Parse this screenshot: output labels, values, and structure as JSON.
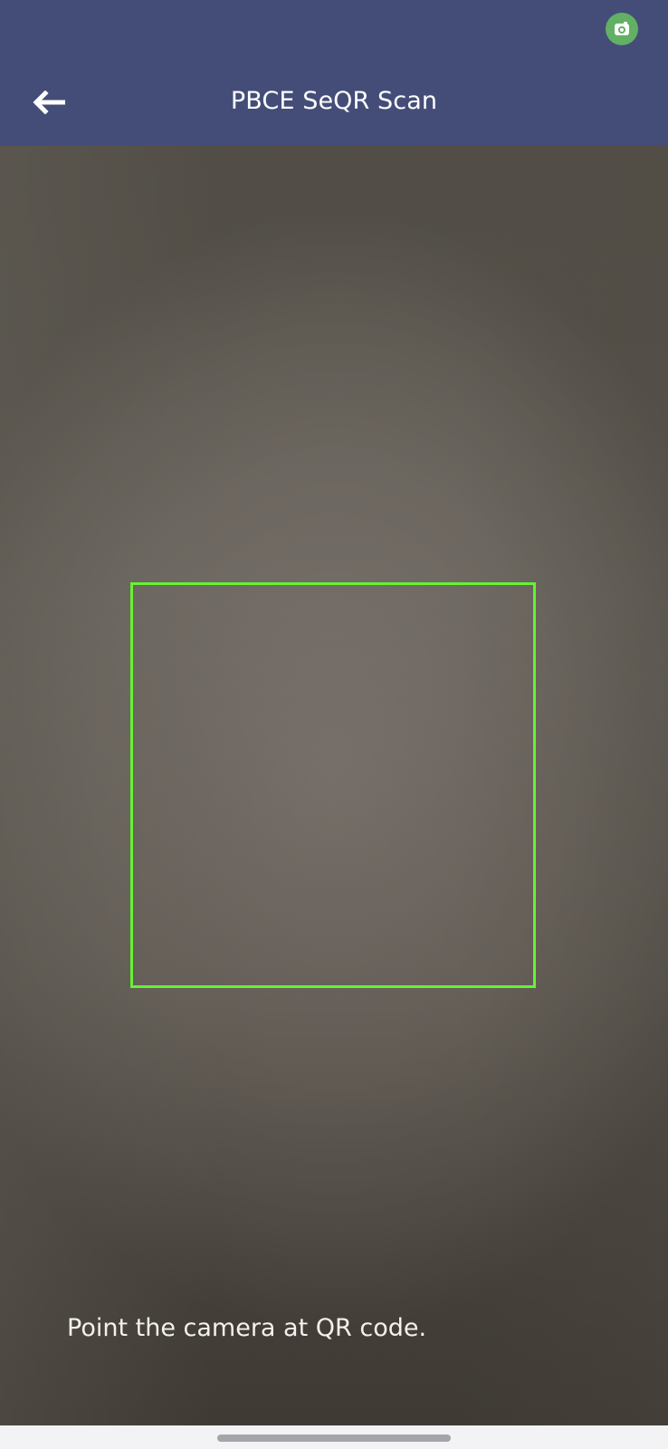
{
  "app_bar": {
    "title": "PBCE SeQR Scan",
    "background_color": "#444d78",
    "back_icon": "arrow-left-icon",
    "status_icon": "camera-icon",
    "status_icon_color": "#62b063"
  },
  "scanner": {
    "frame_color": "#66f233",
    "instruction": "Point the camera at QR code."
  },
  "system_navigation": {
    "indicator": "home-indicator"
  }
}
